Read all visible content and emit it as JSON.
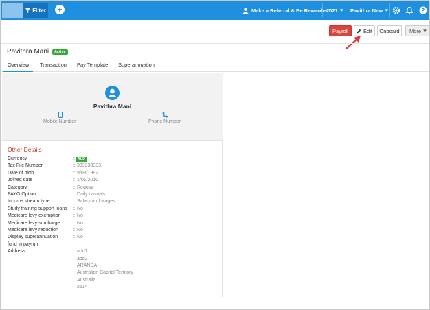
{
  "topbar": {
    "filter_label": "Filter",
    "add_label": "+",
    "referral_label": "Make a Referral & Be Rewarded!",
    "year_label": "2021",
    "user_label": "Pavithra New"
  },
  "actions": {
    "payroll_label": "Payroll",
    "edit_label": "Edit",
    "onboard_label": "Onboard",
    "more_label": "More"
  },
  "employee": {
    "name": "Pavithra Mani",
    "status_badge": "Active"
  },
  "tabs": [
    {
      "label": "Overview",
      "active": true
    },
    {
      "label": "Transaction",
      "active": false
    },
    {
      "label": "Pay Template",
      "active": false
    },
    {
      "label": "Superannuation",
      "active": false
    }
  ],
  "profile_card": {
    "name": "Pavithra Mani",
    "mobile_label": "Mobile Number",
    "phone_label": "Phone Number"
  },
  "other_details": {
    "title": "Other Details",
    "currency_label": "Currency",
    "currency_badge": "AUD",
    "rows": [
      {
        "label": "Tax File Number",
        "value": "333333333"
      },
      {
        "label": "Date of birth",
        "value": "9/08/1992"
      },
      {
        "label": "Joined date",
        "value": "1/01/2010"
      },
      {
        "label": "Category",
        "value": "Regular"
      },
      {
        "label": "PAYG Option",
        "value": "Daily casuals"
      },
      {
        "label": "Income stream type",
        "value": "Salary and wages"
      },
      {
        "label": "Study training support loans",
        "value": "No"
      },
      {
        "label": "Medicare levy exemption",
        "value": "No"
      },
      {
        "label": "Medicare levy surcharge",
        "value": "No"
      },
      {
        "label": "Medicare levy reduction",
        "value": "No"
      },
      {
        "label": "Display superannuation",
        "value": "No"
      }
    ],
    "display_super_cont": "fund in payrun",
    "address_label": "Address",
    "address_lines": [
      "add1",
      "add2",
      "ARANDA",
      "Australian Capital Territory",
      "Australia",
      "2614"
    ]
  },
  "colors": {
    "topbar": "#1f8fe0",
    "payroll": "#d9463e",
    "active_badge": "#3aa63a",
    "section_title": "#c0392b"
  }
}
